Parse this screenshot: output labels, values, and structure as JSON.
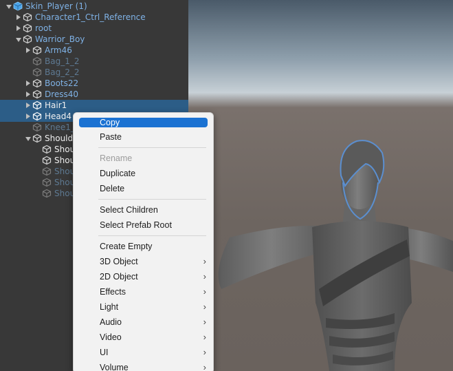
{
  "hierarchy": {
    "items": [
      {
        "label": "Skin_Player (1)",
        "style": "prefab"
      },
      {
        "label": "Character1_Ctrl_Reference",
        "style": "prefab"
      },
      {
        "label": "root",
        "style": "prefab"
      },
      {
        "label": "Warrior_Boy",
        "style": "prefab"
      },
      {
        "label": "Arm46",
        "style": "prefab"
      },
      {
        "label": "Bag_1_2",
        "style": "prefab-dim"
      },
      {
        "label": "Bag_2_2",
        "style": "prefab-dim"
      },
      {
        "label": "Boots22",
        "style": "prefab"
      },
      {
        "label": "Dress40",
        "style": "prefab"
      },
      {
        "label": "Hair1",
        "style": "white"
      },
      {
        "label": "Head4",
        "style": "white"
      },
      {
        "label": "Knee1_",
        "style": "prefab-dim"
      },
      {
        "label": "Should",
        "style": "white"
      },
      {
        "label": "Shou",
        "style": "white"
      },
      {
        "label": "Shou",
        "style": "white"
      },
      {
        "label": "Shou",
        "style": "prefab-dim"
      },
      {
        "label": "Shou",
        "style": "prefab-dim"
      },
      {
        "label": "Shou",
        "style": "prefab-dim"
      }
    ]
  },
  "context_menu": {
    "copy": "Copy",
    "paste": "Paste",
    "rename": "Rename",
    "duplicate": "Duplicate",
    "delete": "Delete",
    "select_children": "Select Children",
    "select_prefab_root": "Select Prefab Root",
    "create_empty": "Create Empty",
    "object_3d": "3D Object",
    "object_2d": "2D Object",
    "effects": "Effects",
    "light": "Light",
    "audio": "Audio",
    "video": "Video",
    "ui": "UI",
    "volume": "Volume",
    "submenu_glyph": "›"
  },
  "colors": {
    "selection": "#2c5d87",
    "menu_highlight": "#1b72d2",
    "prefab_text": "#7fb2e6"
  }
}
